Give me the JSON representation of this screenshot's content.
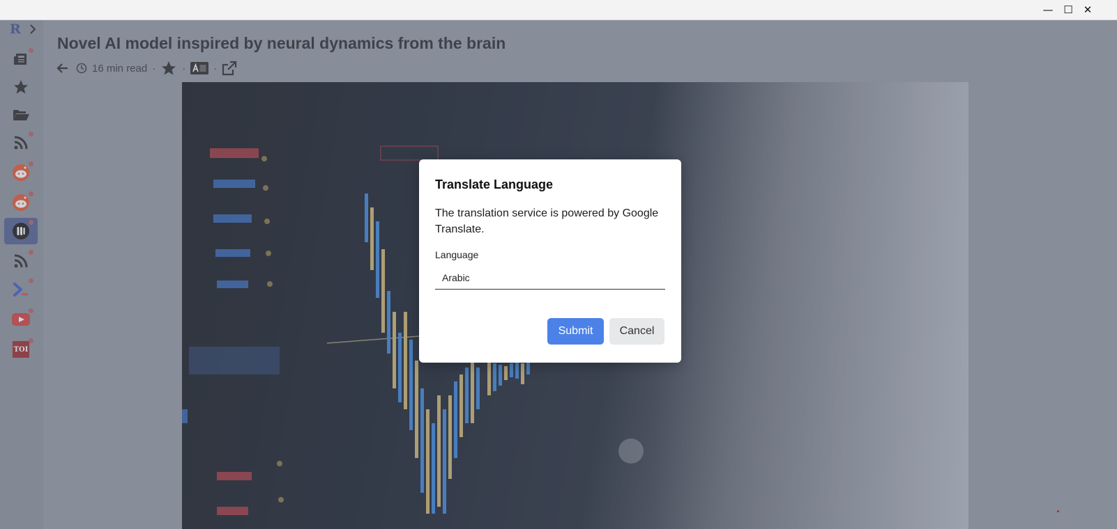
{
  "window": {
    "minimize_label": "—",
    "maximize_label": "☐",
    "close_label": "✕"
  },
  "sidebar": {
    "logo": "R",
    "items": [
      {
        "icon": "newspaper-icon",
        "unread": true
      },
      {
        "icon": "star-icon",
        "unread": false
      },
      {
        "icon": "folder-open-icon",
        "unread": false
      },
      {
        "icon": "rss-icon",
        "unread": true
      },
      {
        "icon": "reddit-icon",
        "unread": true
      },
      {
        "icon": "reddit-icon",
        "unread": true
      },
      {
        "icon": "medium-icon",
        "unread": true,
        "active": true
      },
      {
        "icon": "rss-icon",
        "unread": true
      },
      {
        "icon": "terminal-icon",
        "unread": true
      },
      {
        "icon": "youtube-icon",
        "unread": true
      },
      {
        "icon": "toi-icon",
        "unread": true,
        "text": "TOI"
      }
    ]
  },
  "article": {
    "title": "Novel AI model inspired by neural dynamics from the brain",
    "read_time": "16 min read",
    "separator": "·"
  },
  "dialog": {
    "title": "Translate Language",
    "body": "The translation service is powered by Google Translate.",
    "language_label": "Language",
    "language_value": "Arabic",
    "submit_label": "Submit",
    "cancel_label": "Cancel"
  },
  "colors": {
    "accent": "#4c82e8",
    "unread_dot": "#b55a5f",
    "active_item": "#4a5a8f"
  }
}
